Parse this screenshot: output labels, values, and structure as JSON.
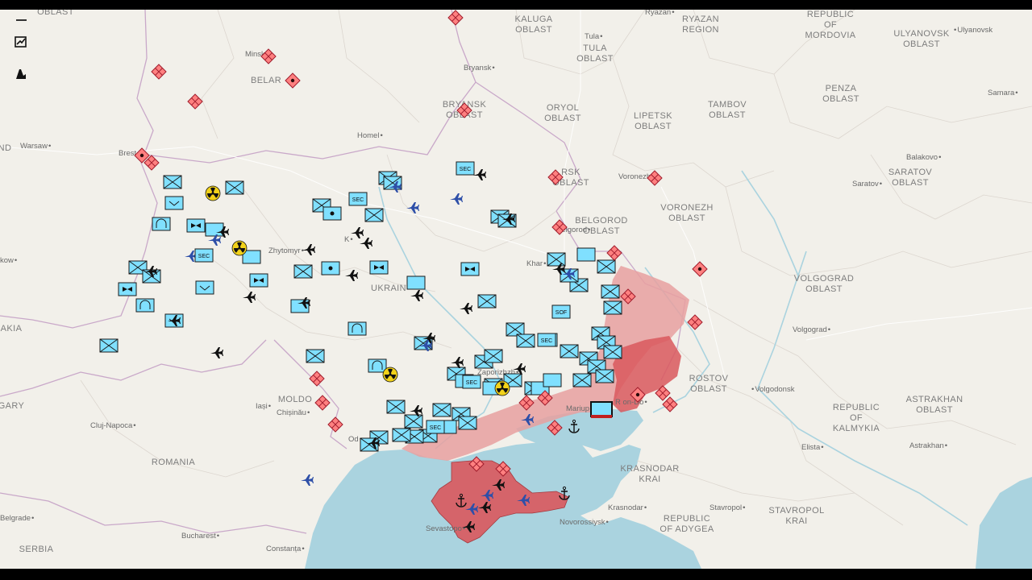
{
  "map": {
    "region_labels": [
      {
        "id": "kaluga",
        "text": "KALUGA\nOBLAST"
      },
      {
        "id": "ryazan",
        "text": "RYAZAN\nREGION"
      },
      {
        "id": "mordovia",
        "text": "REPUBLIC\nOF\nMORDOVIA"
      },
      {
        "id": "ulyanovsk",
        "text": "ULYANOVSK\nOBLAST"
      },
      {
        "id": "tula",
        "text": "TULA\nOBLAST"
      },
      {
        "id": "belarus",
        "text": "BELAR"
      },
      {
        "id": "bryansk",
        "text": "BRYANSK\nOBLAST"
      },
      {
        "id": "oryol",
        "text": "ORYOL\nOBLAST"
      },
      {
        "id": "lipetsk",
        "text": "LIPETSK\nOBLAST"
      },
      {
        "id": "tambov",
        "text": "TAMBOV\nOBLAST"
      },
      {
        "id": "penza",
        "text": "PENZA\nOBLAST"
      },
      {
        "id": "kursk",
        "text": "RSK\nOBLAST"
      },
      {
        "id": "saratov",
        "text": "SARATOV\nOBLAST"
      },
      {
        "id": "belgorod",
        "text": "BELGOROD\nOBLAST"
      },
      {
        "id": "voronezh",
        "text": "VORONEZH\nOBLAST"
      },
      {
        "id": "ukraine",
        "text": "UKRAIN"
      },
      {
        "id": "volgograd",
        "text": "VOLGOGRAD\nOBLAST"
      },
      {
        "id": "rostov",
        "text": "ROSTOV\nOBLAST"
      },
      {
        "id": "moldova",
        "text": "MOLDO"
      },
      {
        "id": "astrakhan",
        "text": "ASTRAKHAN\nOBLAST"
      },
      {
        "id": "kalmykia",
        "text": "REPUBLIC\nOF\nKALMYKIA"
      },
      {
        "id": "romania",
        "text": "ROMANIA"
      },
      {
        "id": "krasnodar",
        "text": "KRASNODAR\nKRAI"
      },
      {
        "id": "adygea",
        "text": "REPUBLIC\nOF ADYGEA"
      },
      {
        "id": "stavropol",
        "text": "STAVROPOL\nKRAI"
      },
      {
        "id": "serbia",
        "text": "SERBIA"
      },
      {
        "id": "oblast-top-left",
        "text": "OBLAST"
      },
      {
        "id": "poland-edge",
        "text": "ND"
      },
      {
        "id": "slovakia-edge",
        "text": "AKIA"
      },
      {
        "id": "hungary-edge",
        "text": "GARY"
      }
    ],
    "cities": [
      {
        "id": "ryazan",
        "text": "Ryazan"
      },
      {
        "id": "ulyanovsk",
        "text": "Ulyanovsk"
      },
      {
        "id": "tula",
        "text": "Tula"
      },
      {
        "id": "minsk",
        "text": "Minsk"
      },
      {
        "id": "bryansk",
        "text": "Bryansk"
      },
      {
        "id": "samara",
        "text": "Samara"
      },
      {
        "id": "homel",
        "text": "Homel"
      },
      {
        "id": "warsaw",
        "text": "Warsaw"
      },
      {
        "id": "brest",
        "text": "Brest"
      },
      {
        "id": "balakovo",
        "text": "Balakovo"
      },
      {
        "id": "voronezh",
        "text": "Voronezh"
      },
      {
        "id": "saratov",
        "text": "Saratov"
      },
      {
        "id": "belgorod",
        "text": "Belgorod"
      },
      {
        "id": "zhytomyr",
        "text": "Zhytomyr"
      },
      {
        "id": "kharkiv",
        "text": "Khar"
      },
      {
        "id": "krakow",
        "text": "kow"
      },
      {
        "id": "volgograd",
        "text": "Volgograd"
      },
      {
        "id": "volgodonsk",
        "text": "Volgodonsk"
      },
      {
        "id": "zaporizhzhia",
        "text": "Zaporizhzh"
      },
      {
        "id": "iasi",
        "text": "Iași"
      },
      {
        "id": "chisinau",
        "text": "Chișinău"
      },
      {
        "id": "cluj",
        "text": "Cluj-Napoca"
      },
      {
        "id": "mariupol",
        "text": "Mariup"
      },
      {
        "id": "rostov",
        "text": "R    on-Do"
      },
      {
        "id": "odesa",
        "text": "Od"
      },
      {
        "id": "elista",
        "text": "Elista"
      },
      {
        "id": "astrakhan",
        "text": "Astrakhan"
      },
      {
        "id": "krasnodar",
        "text": "Krasnodar"
      },
      {
        "id": "stavropol",
        "text": "Stavropol"
      },
      {
        "id": "novorossiysk",
        "text": "Novorossiysk"
      },
      {
        "id": "sevastopol",
        "text": "Sevastopo"
      },
      {
        "id": "belgrade",
        "text": "Belgrade"
      },
      {
        "id": "bucharest",
        "text": "Bucharest"
      },
      {
        "id": "constanta",
        "text": "Constanța"
      },
      {
        "id": "kyiv",
        "text": "K"
      }
    ],
    "unit_tags": {
      "sec": "SEC",
      "sof": "SOF"
    },
    "colors": {
      "friendly_fill": "#80e0ff",
      "friendly_stroke": "#1a1a1a",
      "hostile_fill": "#ff8080",
      "hostile_stroke": "#a01c2c",
      "occupied": "#d9585d",
      "occupied_light": "#e8a0a0",
      "sea": "#aad3df",
      "land": "#f2f0ea",
      "aircraft_friendly": "#2e4fa8",
      "aircraft_other": "#111111",
      "nuclear": "#f2d21a"
    }
  },
  "toolbar": {
    "menu_icon": "hamburger-menu-icon",
    "tool1_icon": "chart-edit-icon",
    "tool2_icon": "measure-icon"
  }
}
